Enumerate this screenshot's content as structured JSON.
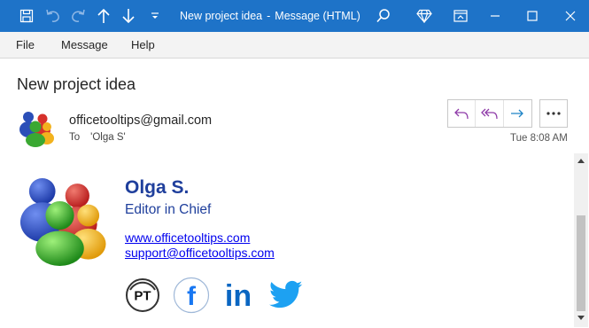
{
  "window": {
    "title": "New project idea",
    "separator": "-",
    "app_label": "Message (HTML)"
  },
  "titlebar_icons": [
    "save-icon",
    "undo-icon",
    "redo-icon",
    "previous-item-icon",
    "next-item-icon",
    "customize-toolbar-icon",
    "search-icon",
    "premium-diamond-icon",
    "restore-ribbon-icon",
    "minimize-icon",
    "maximize-icon",
    "close-icon"
  ],
  "menu": {
    "items": [
      "File",
      "Message",
      "Help"
    ]
  },
  "message": {
    "subject": "New project idea",
    "sender": "officetooltips@gmail.com",
    "to_label": "To",
    "to_value": "'Olga S'",
    "timestamp": "Tue 8:08 AM",
    "actions": [
      "reply-icon",
      "reply-all-icon",
      "forward-icon",
      "more-options-icon"
    ]
  },
  "signature": {
    "name": "Olga S.",
    "title": "Editor in Chief",
    "website": "www.officetooltips.com",
    "email": "support@officetooltips.com",
    "social": [
      {
        "name": "pt-icon",
        "text": "PT"
      },
      {
        "name": "facebook-icon",
        "text": "f"
      },
      {
        "name": "linkedin-icon",
        "text": "in"
      },
      {
        "name": "twitter-icon",
        "text": ""
      }
    ]
  },
  "colors": {
    "titlebar": "#1e73c8",
    "accent_purple": "#8e3aa8",
    "accent_blue": "#1f84c6",
    "signature_blue": "#1f3f9c",
    "link": "#0000ee",
    "facebook": "#1877f2",
    "linkedin": "#0a66c2",
    "twitter": "#1da1f2"
  }
}
